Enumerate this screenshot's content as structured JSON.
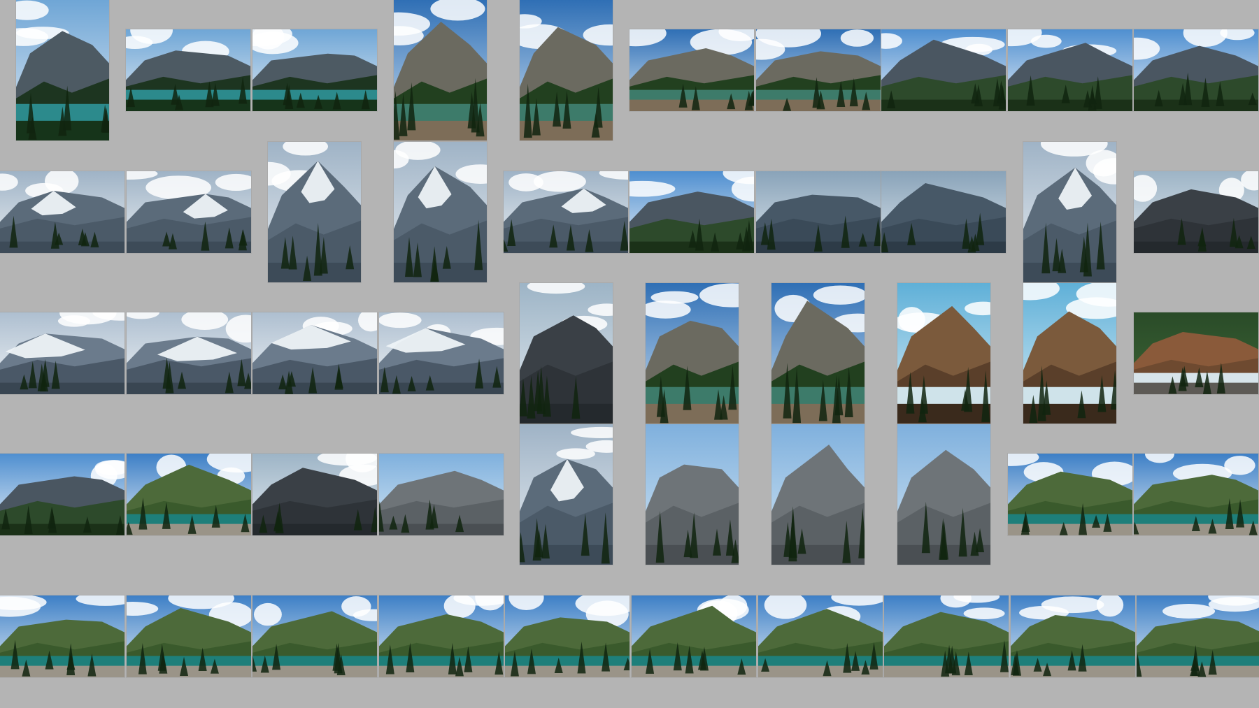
{
  "thumbnails": [
    {
      "kind": "forest-lake",
      "orientation": "portrait"
    },
    {
      "kind": "forest-lake",
      "orientation": "landscape"
    },
    {
      "kind": "forest-lake",
      "orientation": "landscape"
    },
    {
      "kind": "rock-lake",
      "orientation": "portrait"
    },
    {
      "kind": "rock-lake",
      "orientation": "portrait"
    },
    {
      "kind": "rock-lake",
      "orientation": "landscape"
    },
    {
      "kind": "rock-lake",
      "orientation": "landscape"
    },
    {
      "kind": "valley",
      "orientation": "landscape"
    },
    {
      "kind": "valley",
      "orientation": "landscape"
    },
    {
      "kind": "valley",
      "orientation": "landscape"
    },
    {
      "kind": "glacier",
      "orientation": "landscape"
    },
    {
      "kind": "glacier",
      "orientation": "landscape"
    },
    {
      "kind": "glacier",
      "orientation": "portrait"
    },
    {
      "kind": "glacier",
      "orientation": "portrait"
    },
    {
      "kind": "glacier",
      "orientation": "landscape"
    },
    {
      "kind": "valley",
      "orientation": "landscape"
    },
    {
      "kind": "mountain",
      "orientation": "landscape"
    },
    {
      "kind": "mountain",
      "orientation": "landscape"
    },
    {
      "kind": "glacier",
      "orientation": "portrait"
    },
    {
      "kind": "cliff",
      "orientation": "landscape"
    },
    {
      "kind": "snow-peak",
      "orientation": "landscape"
    },
    {
      "kind": "snow-peak",
      "orientation": "landscape"
    },
    {
      "kind": "snow-peak",
      "orientation": "landscape"
    },
    {
      "kind": "snow-peak",
      "orientation": "landscape"
    },
    {
      "kind": "cliff",
      "orientation": "portrait"
    },
    {
      "kind": "rock-lake",
      "orientation": "portrait"
    },
    {
      "kind": "rock-lake",
      "orientation": "portrait"
    },
    {
      "kind": "waterfall",
      "orientation": "portrait"
    },
    {
      "kind": "waterfall",
      "orientation": "portrait"
    },
    {
      "kind": "stream",
      "orientation": "landscape"
    },
    {
      "kind": "valley",
      "orientation": "landscape"
    },
    {
      "kind": "lake-shore",
      "orientation": "landscape"
    },
    {
      "kind": "cliff",
      "orientation": "landscape"
    },
    {
      "kind": "spires",
      "orientation": "landscape"
    },
    {
      "kind": "glacier",
      "orientation": "portrait"
    },
    {
      "kind": "spires",
      "orientation": "portrait"
    },
    {
      "kind": "spires",
      "orientation": "portrait"
    },
    {
      "kind": "spires",
      "orientation": "portrait"
    },
    {
      "kind": "lake-shore",
      "orientation": "landscape"
    },
    {
      "kind": "lake-shore",
      "orientation": "landscape"
    },
    {
      "kind": "lake-shore",
      "orientation": "landscape"
    },
    {
      "kind": "lake-shore",
      "orientation": "landscape"
    },
    {
      "kind": "lake-shore",
      "orientation": "landscape"
    },
    {
      "kind": "lake-shore",
      "orientation": "landscape"
    },
    {
      "kind": "lake-shore",
      "orientation": "landscape"
    },
    {
      "kind": "lake-shore",
      "orientation": "landscape"
    },
    {
      "kind": "lake-shore",
      "orientation": "landscape"
    },
    {
      "kind": "lake-shore",
      "orientation": "landscape"
    },
    {
      "kind": "lake-shore",
      "orientation": "landscape"
    },
    {
      "kind": "lake-shore",
      "orientation": "landscape"
    }
  ],
  "colors": {
    "background": "#b4b4b4"
  }
}
